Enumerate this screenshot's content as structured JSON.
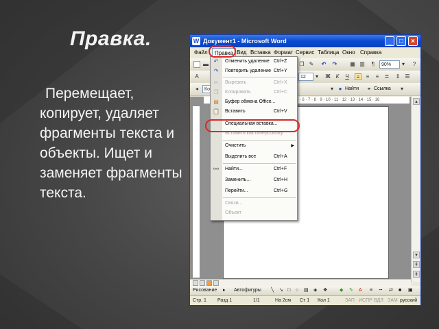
{
  "slide": {
    "title": "Правка.",
    "body": "Перемещает, копирует, удаляет фрагменты текста и объекты. Ищет и заменяет фрагменты текста."
  },
  "window": {
    "title": "Документ1 - Microsoft Word",
    "icon_letter": "W",
    "min_label": "_",
    "max_label": "□",
    "close_label": "×"
  },
  "menubar": {
    "items": [
      "Файл",
      "Правка",
      "Вид",
      "Вставка",
      "Формат",
      "Сервис",
      "Таблица",
      "Окно",
      "Справка"
    ]
  },
  "toolbar": {
    "zoom": "90%",
    "font_size": "12",
    "style_field": "Ко",
    "find_label": "Найти",
    "links_label": "Ссылка"
  },
  "ruler": {
    "marks": "1 · 2 · 3 · 4 · 5 · 6 · 7 · 8 · 9 · 10 · 11 · 12 · 13 · 14 · 15 · 16"
  },
  "edit_menu": {
    "items": [
      {
        "label": "Отменить удаление",
        "shortcut": "Ctrl+Z",
        "disabled": false
      },
      {
        "label": "Повторить удаление",
        "shortcut": "Ctrl+Y",
        "disabled": false
      },
      {
        "label": "Вырезать",
        "shortcut": "Ctrl+X",
        "disabled": true
      },
      {
        "label": "Копировать",
        "shortcut": "Ctrl+C",
        "disabled": true
      },
      {
        "label": "Буфер обмена Office...",
        "shortcut": "",
        "disabled": false
      },
      {
        "label": "Вставить",
        "shortcut": "Ctrl+V",
        "disabled": false
      },
      {
        "label": "Специальная вставка...",
        "shortcut": "",
        "disabled": false
      },
      {
        "label": "Вставить как гиперссылку",
        "shortcut": "",
        "disabled": true
      },
      {
        "label": "Очистить",
        "shortcut": "",
        "disabled": false
      },
      {
        "label": "Выделить все",
        "shortcut": "Ctrl+A",
        "disabled": false
      },
      {
        "label": "Найти...",
        "shortcut": "Ctrl+F",
        "disabled": false
      },
      {
        "label": "Заменить...",
        "shortcut": "Ctrl+H",
        "disabled": false
      },
      {
        "label": "Перейти...",
        "shortcut": "Ctrl+G",
        "disabled": false
      },
      {
        "label": "Связи...",
        "shortcut": "",
        "disabled": true
      },
      {
        "label": "Объект",
        "shortcut": "",
        "disabled": true
      }
    ]
  },
  "drawbar": {
    "draw_label": "Рисование",
    "autoshapes_label": "Автофигуры"
  },
  "statusbar": {
    "page": "Стр. 1",
    "section": "Разд 1",
    "pages": "1/1",
    "position": "На 2см",
    "line": "Ст 1",
    "col": "Кол 1",
    "flags": [
      "ЗАП",
      "ИСПР",
      "ВДЛ",
      "ЗАМ"
    ],
    "lang": "русский"
  },
  "colors": {
    "highlight_ring": "#d42a2a",
    "titlebar": "#0a4ad0"
  }
}
